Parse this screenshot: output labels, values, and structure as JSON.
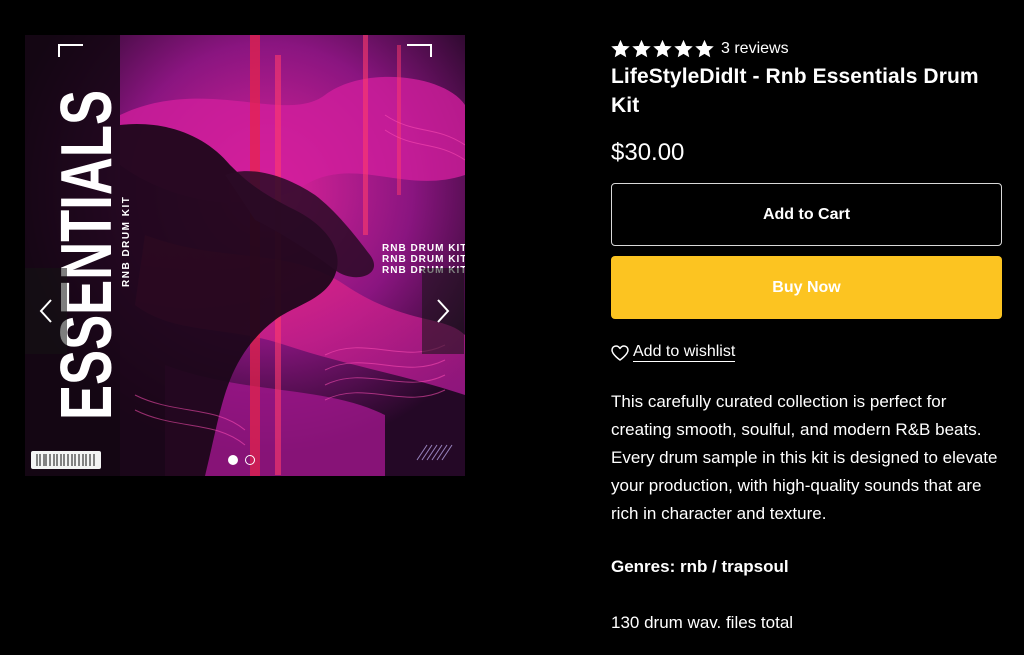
{
  "product": {
    "rating": 5,
    "reviews_label": "3 reviews",
    "title": "LifeStyleDidIt - Rnb Essentials Drum Kit",
    "price": "$30.00",
    "add_to_cart_label": "Add to Cart",
    "buy_now_label": "Buy Now",
    "wishlist_label": "Add to wishlist",
    "description": "This carefully curated collection is perfect for creating smooth, soulful, and modern R&B beats. Every drum sample in this kit is designed to elevate your production, with high-quality sounds that are rich in character and texture.",
    "genres": "Genres: rnb / trapsoul",
    "files": "130 drum wav. files total"
  },
  "gallery": {
    "cover_title": "ESSENTIALS",
    "cover_subtitle": "RNB DRUM KIT",
    "cover_tag_lines": [
      "RNB DRUM KIT",
      "RNB DRUM KIT",
      "RNB DRUM KIT"
    ],
    "slide_count": 2,
    "active_slide": 1
  },
  "colors": {
    "background": "#000000",
    "text": "#ffffff",
    "buy_button": "#fcc421",
    "cover_magenta": "#c21fa8",
    "cover_pink": "#e8246a"
  },
  "icons": {
    "rating": "star-icon",
    "prev": "chevron-left-icon",
    "next": "chevron-right-icon",
    "wishlist": "heart-icon"
  }
}
